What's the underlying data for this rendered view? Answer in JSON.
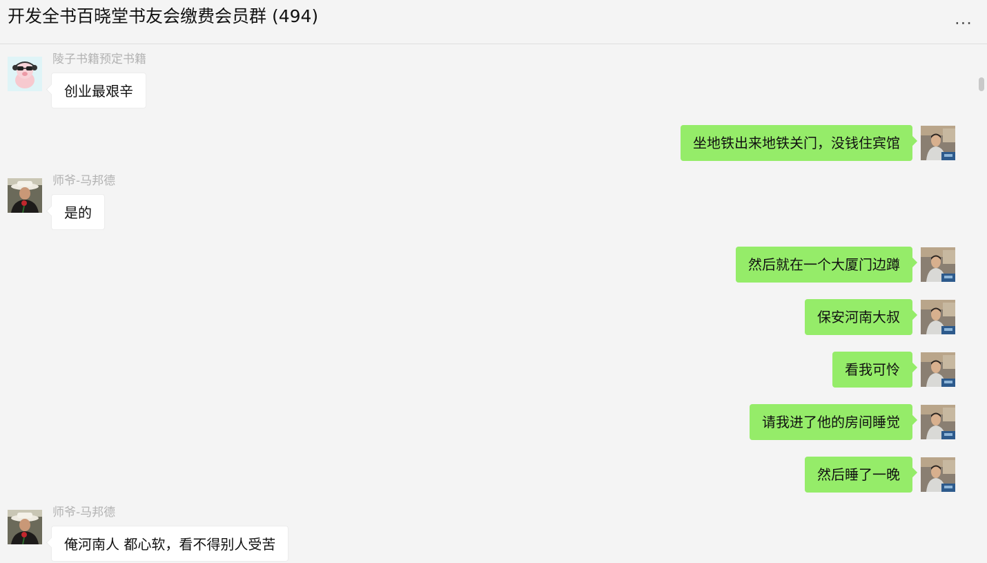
{
  "header": {
    "title": "开发全书百晓堂书友会缴费会员群 (494)",
    "more_icon": "more-horizontal-icon",
    "more_label": "···"
  },
  "messages": [
    {
      "side": "left",
      "sender": "陵子书籍预定书籍",
      "text": "创业最艰辛",
      "avatar": "pig-avatar"
    },
    {
      "side": "right",
      "text": "坐地铁出来地铁关门，没钱住宾馆",
      "avatar": "self-avatar"
    },
    {
      "side": "left",
      "sender": "师爷-马邦德",
      "text": "是的",
      "avatar": "hat-avatar"
    },
    {
      "side": "right",
      "text": "然后就在一个大厦门边蹲",
      "avatar": "self-avatar"
    },
    {
      "side": "right",
      "text": "保安河南大叔",
      "avatar": "self-avatar"
    },
    {
      "side": "right",
      "text": "看我可怜",
      "avatar": "self-avatar"
    },
    {
      "side": "right",
      "text": "请我进了他的房间睡觉",
      "avatar": "self-avatar"
    },
    {
      "side": "right",
      "text": "然后睡了一晚",
      "avatar": "self-avatar"
    },
    {
      "side": "left",
      "sender": "师爷-马邦德",
      "text": "俺河南人 都心软，看不得别人受苦",
      "avatar": "hat-avatar"
    }
  ],
  "colors": {
    "background": "#f4f4f4",
    "self_bubble": "#95ec69",
    "other_bubble": "#ffffff",
    "sender_name": "#b2b2b2"
  }
}
